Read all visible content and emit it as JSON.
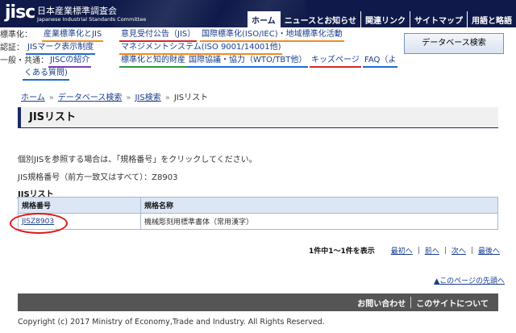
{
  "header": {
    "logo_mark": "jisc",
    "logo_ja": "日本産業標準調査会",
    "logo_en": "Japanese Industrial Standards Committee",
    "nav": [
      "ホーム",
      "ニュースとお知らせ",
      "関連リンク",
      "サイトマップ",
      "用語と略語"
    ]
  },
  "categories": {
    "row1_label": "標準化：",
    "row1_links": [
      "産業標準化とJIS",
      "意見受付公告（JIS）",
      "国際標準化(ISO/IEC)・地域標準化活動"
    ],
    "row2_label": "認証：",
    "row2_links": [
      "JISマーク表示制度",
      "マネジメントシステム(ISO 9001/14001他)"
    ],
    "row3_label": "一般・共通：",
    "row3_links": [
      "JISCの紹介",
      "標準化と知的財産",
      "国際協議・協力（WTO/TBT他）",
      "キッズページ",
      "FAQ（よ"
    ],
    "row4_text": "くある質問)"
  },
  "db_search_button": "データベース検索",
  "breadcrumb": [
    "ホーム",
    "データベース検索",
    "JIS検索",
    "JISリスト"
  ],
  "page_title": "JISリスト",
  "instruction": "個別JISを参照する場合は、「規格番号」をクリックしてください。",
  "query_line": "JIS規格番号（前方一致又はすべて）：Z8903",
  "list_heading": "JISリスト",
  "table": {
    "headers": [
      "規格番号",
      "規格名称"
    ],
    "rows": [
      {
        "number": "JISZ8903",
        "name": "機械彫刻用標準書体（常用漢字）"
      }
    ]
  },
  "pager": {
    "count_text": "1件中1～1件を表示",
    "first": "最初へ",
    "prev": "前へ",
    "next": "次へ",
    "last": "最後へ"
  },
  "back_to_top": "▲このページの先頭へ",
  "footer": {
    "contact": "お問い合わせ",
    "about": "このサイトについて"
  },
  "copyright": "Copyright (c) 2017 Ministry of Economy,Trade and Industry. All Rights Reserved.",
  "colors": {
    "header_bg": "#0f1a4a",
    "annotation_circle": "#e01818",
    "table_header_bg": "#dce6f5",
    "footer_bg": "#555555"
  }
}
